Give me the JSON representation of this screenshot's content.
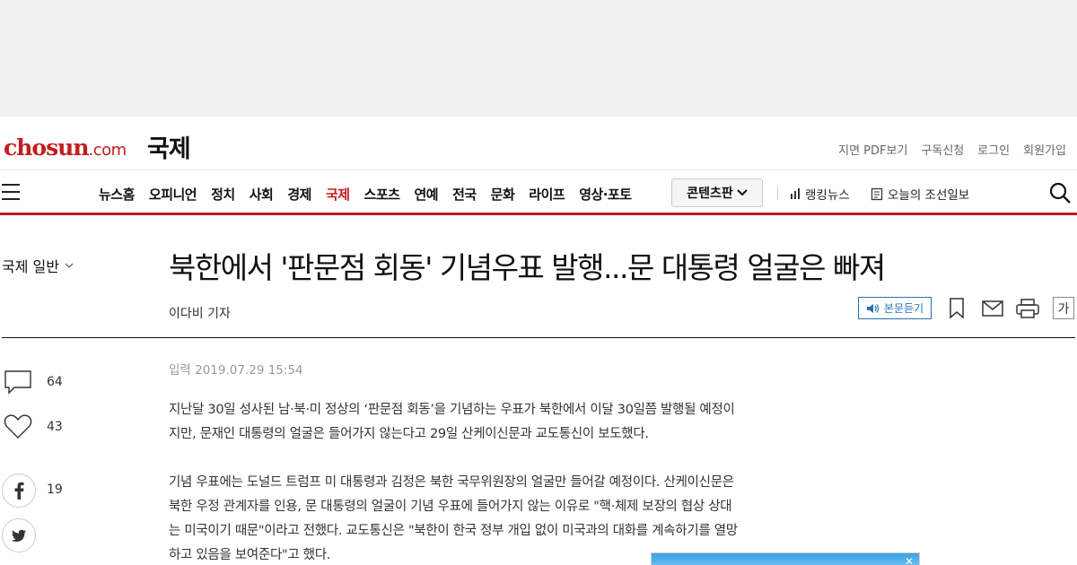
{
  "header": {
    "logo": "chosun",
    "logo_suffix": ".com",
    "section": "국제",
    "util_links": [
      "지면 PDF보기",
      "구독신청",
      "로그인",
      "회원가입"
    ]
  },
  "nav": {
    "items": [
      "뉴스홈",
      "오피니언",
      "정치",
      "사회",
      "경제",
      "국제",
      "스포츠",
      "연예",
      "전국",
      "문화",
      "라이프",
      "영상·포토"
    ],
    "active": "국제",
    "contents_button": "콘텐츠판",
    "ranking": "랭킹뉴스",
    "today": "오늘의 조선일보"
  },
  "article": {
    "category": "국제 일반",
    "headline": "북한에서 '판문점 회동' 기념우표 발행...문 대통령 얼굴은 빠져",
    "byline": "이다비 기자",
    "date": "입력 2019.07.29 15:54",
    "tts_label": "본문듣기",
    "font_label": "가",
    "paragraphs": [
      "지난달 30일 성사된 남·북·미 정상의 ‘판문점 회동’을 기념하는 우표가 북한에서 이달 30일쯤 발행될 예정이지만, 문재인 대통령의 얼굴은 들어가지 않는다고 29일 산케이신문과 교도통신이 보도했다.",
      "기념 우표에는 도널드 트럼프 미 대통령과 김정은 북한 국무위원장의 얼굴만 들어갈 예정이다. 산케이신문은 북한 우정 관계자를 인용, 문 대통령의 얼굴이 기념 우표에 들어가지 않는 이유로 \"핵·체제 보장의 협상 상대는 미국이기 때문\"이라고 전했다. 교도통신은 \"북한이 한국 정부 개입 없이 미국과의 대화를 계속하기를 열망하고 있음을 보여준다\"고 했다."
    ]
  },
  "share": {
    "comments": "64",
    "likes": "43",
    "facebook": "19"
  },
  "colors": {
    "brand": "#c41c1c",
    "tts": "#2a6fb6"
  }
}
